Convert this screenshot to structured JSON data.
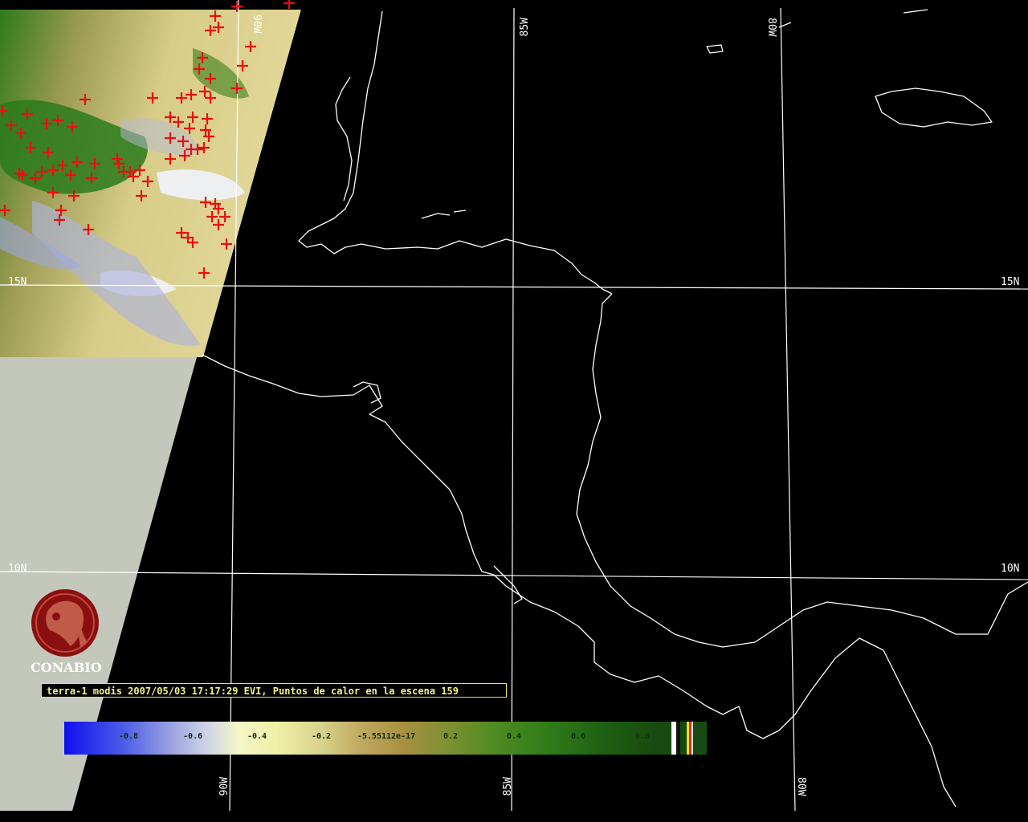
{
  "map": {
    "lat_labels": [
      "15N",
      "10N"
    ],
    "lon_labels": [
      "85W",
      "80W",
      "90W"
    ],
    "top_lon_label_90W": "90W"
  },
  "logo": {
    "name": "CONABIO",
    "icon": "conabio-macaw-seal-icon"
  },
  "caption": {
    "text": "terra-1 modis 2007/05/03 17:17:29 EVI, Puntos de calor en la escena 159"
  },
  "colorbar": {
    "ticks": [
      "-0.8",
      "-0.6",
      "-0.4",
      "-0.2",
      "-5.55112e-17",
      "0.2",
      "0.4",
      "0.6",
      "0.8"
    ]
  },
  "colors": {
    "background": "#000000",
    "no_data": "#c4c8bc",
    "fire_marker": "#e81010",
    "coastline": "#ffffff",
    "caption_text": "#f5f08a"
  }
}
